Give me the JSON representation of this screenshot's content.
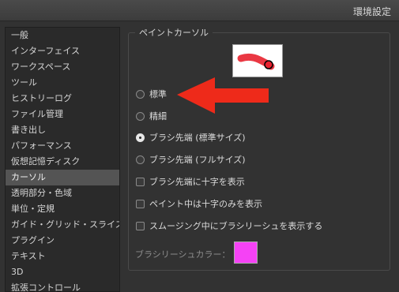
{
  "window": {
    "title": "環境設定"
  },
  "sidebar": {
    "items": [
      {
        "label": "一般"
      },
      {
        "label": "インターフェイス"
      },
      {
        "label": "ワークスペース"
      },
      {
        "label": "ツール"
      },
      {
        "label": "ヒストリーログ"
      },
      {
        "label": "ファイル管理"
      },
      {
        "label": "書き出し"
      },
      {
        "label": "パフォーマンス"
      },
      {
        "label": "仮想記憶ディスク"
      },
      {
        "label": "カーソル"
      },
      {
        "label": "透明部分・色域"
      },
      {
        "label": "単位・定規"
      },
      {
        "label": "ガイド・グリッド・スライス"
      },
      {
        "label": "プラグイン"
      },
      {
        "label": "テキスト"
      },
      {
        "label": "3D"
      },
      {
        "label": "拡張コントロール"
      }
    ],
    "selected": "カーソル"
  },
  "paint_cursor": {
    "section_title": "ペイントカーソル",
    "options": [
      {
        "label": "標準",
        "checked": false
      },
      {
        "label": "精細",
        "checked": false
      },
      {
        "label": "ブラシ先端 (標準サイズ)",
        "checked": true
      },
      {
        "label": "ブラシ先端 (フルサイズ)",
        "checked": false
      }
    ],
    "checkboxes": [
      {
        "label": "ブラシ先端に十字を表示",
        "checked": false
      },
      {
        "label": "ペイント中は十字のみを表示",
        "checked": false
      },
      {
        "label": "スムージング中にブラシリーシュを表示する",
        "checked": false
      }
    ],
    "leash_color_label": "ブラシリーシュカラー：",
    "leash_color": "#f542f5"
  },
  "colors": {
    "arrow": "#ee2a1a",
    "preview_stroke": "#e8222f"
  },
  "icons": {
    "annotation": "red-arrow-icon"
  }
}
